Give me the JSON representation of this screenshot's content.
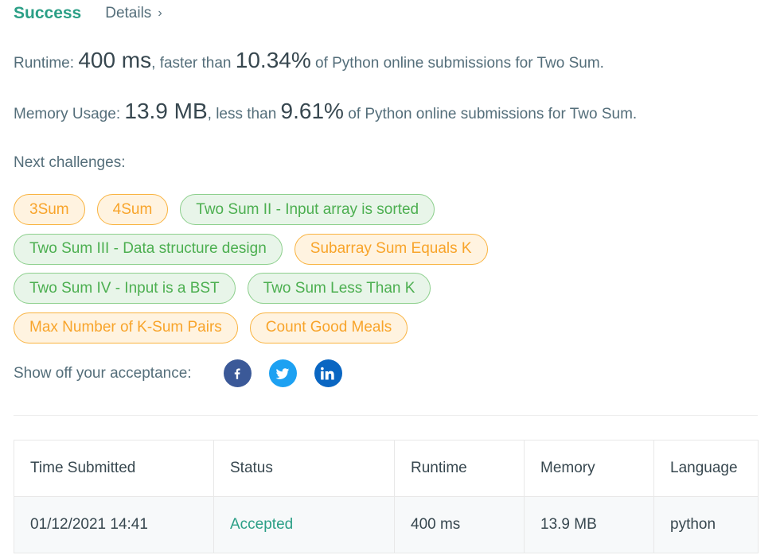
{
  "header": {
    "status": "Success",
    "details_label": "Details",
    "details_chevron": "›"
  },
  "runtime": {
    "label": "Runtime: ",
    "value": "400 ms",
    "mid": ", faster than ",
    "percent": "10.34%",
    "suffix": " of Python online submissions for Two Sum."
  },
  "memory": {
    "label": "Memory Usage: ",
    "value": "13.9 MB",
    "mid": ", less than ",
    "percent": "9.61%",
    "suffix": " of Python online submissions for Two Sum."
  },
  "next_challenges": {
    "label": "Next challenges:",
    "rows": [
      [
        {
          "label": "3Sum",
          "difficulty": "medium"
        },
        {
          "label": "4Sum",
          "difficulty": "medium"
        },
        {
          "label": "Two Sum II - Input array is sorted",
          "difficulty": "easy"
        }
      ],
      [
        {
          "label": "Two Sum III - Data structure design",
          "difficulty": "easy"
        },
        {
          "label": "Subarray Sum Equals K",
          "difficulty": "medium"
        }
      ],
      [
        {
          "label": "Two Sum IV - Input is a BST",
          "difficulty": "easy"
        },
        {
          "label": "Two Sum Less Than K",
          "difficulty": "easy"
        }
      ],
      [
        {
          "label": "Max Number of K-Sum Pairs",
          "difficulty": "medium"
        },
        {
          "label": "Count Good Meals",
          "difficulty": "medium"
        }
      ]
    ]
  },
  "share": {
    "label": "Show off your acceptance:",
    "buttons": [
      "facebook-icon",
      "twitter-icon",
      "linkedin-icon"
    ]
  },
  "table": {
    "headers": [
      "Time Submitted",
      "Status",
      "Runtime",
      "Memory",
      "Language"
    ],
    "rows": [
      [
        "01/12/2021 14:41",
        "Accepted",
        "400 ms",
        "13.9 MB",
        "python"
      ]
    ]
  },
  "colors": {
    "success": "#2b9f86",
    "medium": "#f8a42a",
    "easy": "#4caf50",
    "facebook": "#3b5998",
    "twitter": "#1da1f2",
    "linkedin": "#0a66c2"
  }
}
